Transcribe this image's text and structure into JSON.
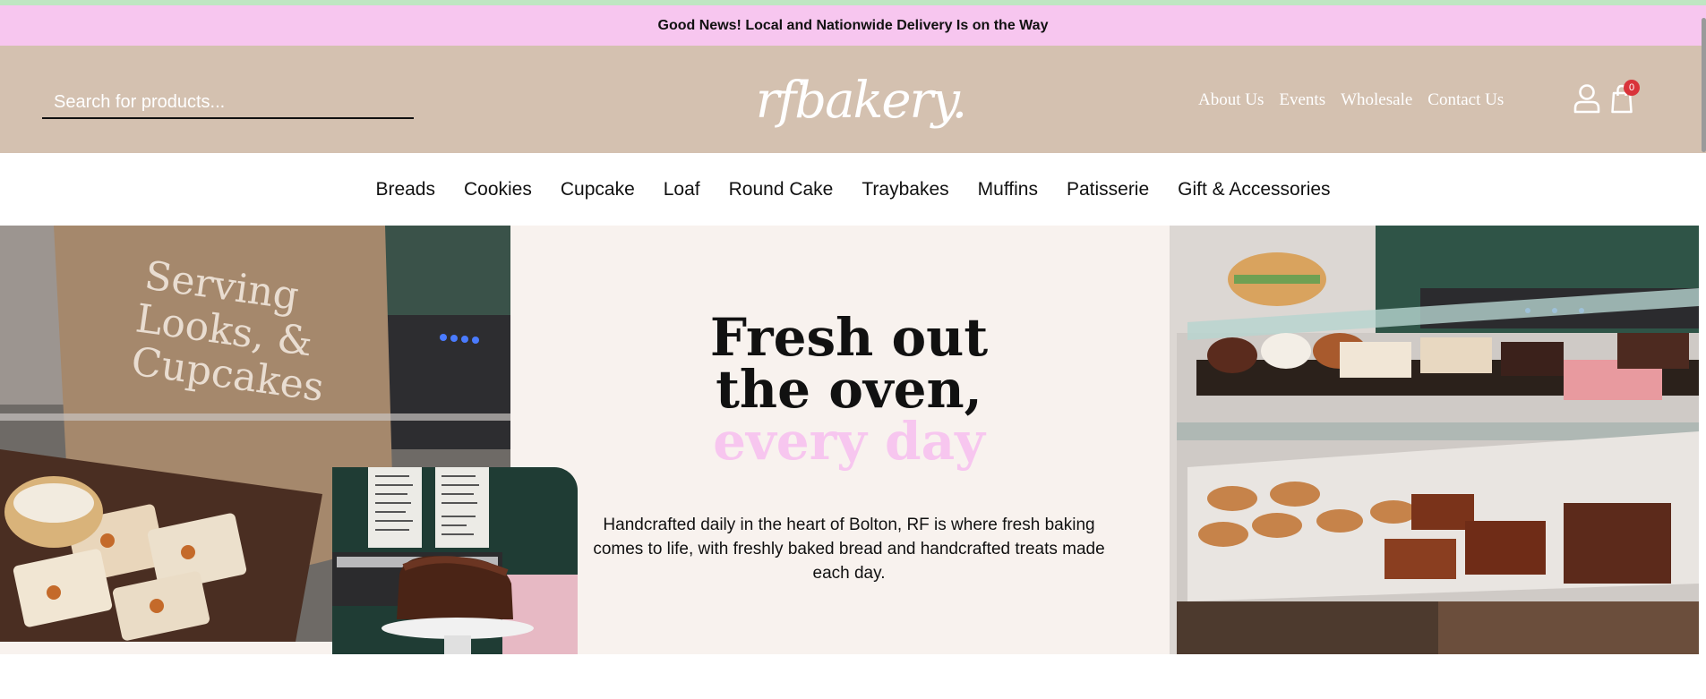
{
  "announcement": "Good News! Local and Nationwide Delivery Is on the Way",
  "search": {
    "placeholder": "Search for products..."
  },
  "logo_text": "rfbakery.",
  "top_nav": [
    "About Us",
    "Events",
    "Wholesale",
    "Contact Us"
  ],
  "icons": {
    "account": "user-icon",
    "cart": "shopping-bag-icon"
  },
  "cart_count": "0",
  "categories": [
    "Breads",
    "Cookies",
    "Cupcake",
    "Loaf",
    "Round Cake",
    "Traybakes",
    "Muffins",
    "Patisserie",
    "Gift & Accessories"
  ],
  "hero": {
    "headline_line1": "Fresh out",
    "headline_line2": "the oven,",
    "headline_accent": "every day",
    "description": "Handcrafted daily in the heart of Bolton, RF is where fresh baking comes to life, with freshly baked bread and handcrafted treats made each day.",
    "shirt_text": [
      "Serving",
      "Looks, &",
      "Cupcakes"
    ]
  },
  "colors": {
    "announcement_bg": "#f7c6ef",
    "header_bg": "#d4c1b0",
    "hero_bg": "#f8f2ee",
    "accent_pink": "#f7c6ef",
    "badge_red": "#d9333a"
  }
}
